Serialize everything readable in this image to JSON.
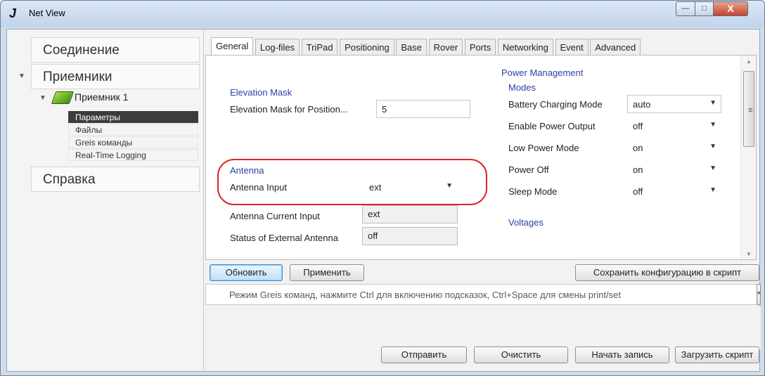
{
  "window": {
    "title": "Net View",
    "min_glyph": "—",
    "max_glyph": "□",
    "close_glyph": "X"
  },
  "nav": {
    "sections": [
      {
        "label": "Соединение"
      },
      {
        "label": "Приемники"
      },
      {
        "label": "Справка"
      }
    ],
    "device": {
      "label": "Приемник 1",
      "items": [
        {
          "label": "Параметры",
          "selected": true
        },
        {
          "label": "Файлы"
        },
        {
          "label": "Greis команды"
        },
        {
          "label": "Real-Time Logging"
        }
      ]
    }
  },
  "tabs": [
    {
      "label": "General",
      "active": true
    },
    {
      "label": "Log-files"
    },
    {
      "label": "TriPad"
    },
    {
      "label": "Positioning"
    },
    {
      "label": "Base"
    },
    {
      "label": "Rover"
    },
    {
      "label": "Ports"
    },
    {
      "label": "Networking"
    },
    {
      "label": "Event"
    },
    {
      "label": "Advanced"
    }
  ],
  "general": {
    "elevation": {
      "title": "Elevation Mask",
      "label": "Elevation Mask for Position...",
      "value": "5"
    },
    "antenna": {
      "title": "Antenna",
      "input_label": "Antenna Input",
      "input_value": "ext",
      "current_label": "Antenna Current Input",
      "current_value": "ext",
      "status_label": "Status of External Antenna",
      "status_value": "off"
    },
    "power": {
      "title": "Power Management",
      "modes_title": "Modes",
      "rows": [
        {
          "label": "Battery Charging Mode",
          "value": "auto"
        },
        {
          "label": "Enable Power Output",
          "value": "off"
        },
        {
          "label": "Low Power Mode",
          "value": "on"
        },
        {
          "label": "Power Off",
          "value": "on"
        },
        {
          "label": "Sleep Mode",
          "value": "off"
        }
      ],
      "voltages_title": "Voltages"
    }
  },
  "actions": {
    "refresh": "Обновить",
    "apply": "Применить",
    "save_script": "Сохранить конфигурацию в скрипт"
  },
  "command": {
    "placeholder": "Режим Greis команд, нажмите  Ctrl для включению подсказок, Ctrl+Space для смены print/set",
    "aux_glyph": "*"
  },
  "bottom": {
    "send": "Отправить",
    "clear": "Очистить",
    "record": "Начать запись",
    "load_script": "Загрузить скрипт"
  },
  "colors": {
    "group_title": "#2b3ea8",
    "annotation": "#d9262c",
    "selected_item_bg": "#3c3c3c",
    "default_button": "#3c8fd6"
  }
}
